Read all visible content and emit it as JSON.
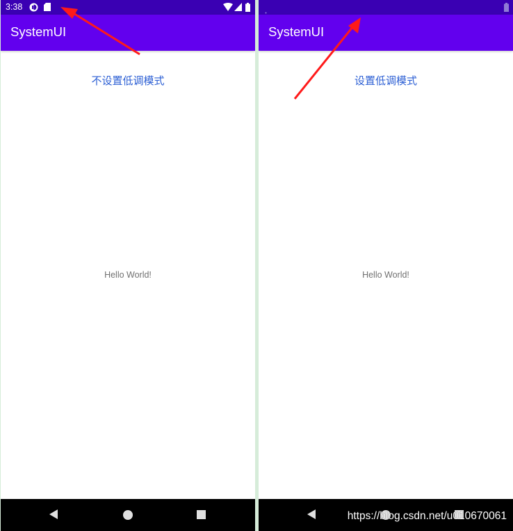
{
  "left_phone": {
    "status_bar": {
      "time": "3:38",
      "icons": [
        "sync-icon",
        "sd-card-icon",
        "wifi-icon",
        "signal-icon",
        "battery-icon"
      ]
    },
    "app_bar": {
      "title": "SystemUI"
    },
    "button": {
      "label": "不设置低调模式"
    },
    "content": {
      "text": "Hello World!"
    },
    "nav_bar": {
      "icons": [
        "back-icon",
        "home-icon",
        "recents-icon"
      ]
    }
  },
  "right_phone": {
    "status_bar": {
      "mode": "low-profile",
      "icons": [
        "battery-icon"
      ]
    },
    "app_bar": {
      "title": "SystemUI"
    },
    "button": {
      "label": "设置低调模式"
    },
    "content": {
      "text": "Hello World!"
    },
    "nav_bar": {
      "icons": [
        "back-icon",
        "home-icon",
        "recents-icon"
      ]
    }
  },
  "watermark": "https://blog.csdn.net/u010670061",
  "colors": {
    "status_bar": "#3a00b3",
    "app_bar": "#6200ee",
    "button_text": "#2c5fd4",
    "annotation_arrow": "#ff1a1a",
    "separator": "#d6ecd9"
  }
}
